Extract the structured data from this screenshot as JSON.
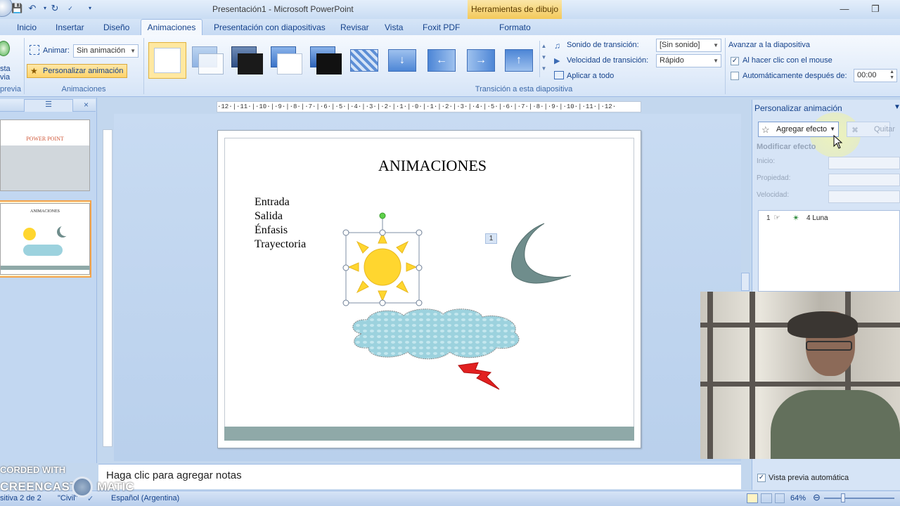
{
  "window": {
    "title": "Presentación1 - Microsoft PowerPoint",
    "context_tab_group": "Herramientas de dibujo"
  },
  "ribbon_tabs": [
    "Inicio",
    "Insertar",
    "Diseño",
    "Animaciones",
    "Presentación con diapositivas",
    "Revisar",
    "Vista",
    "Foxit PDF",
    "Formato"
  ],
  "ribbon": {
    "preview": {
      "label_top": "sta",
      "label_bottom": "via",
      "group": "previa"
    },
    "animaciones_group": {
      "animar_label": "Animar:",
      "animar_value": "Sin animación",
      "personalizar_label": "Personalizar animación",
      "group_label": "Animaciones"
    },
    "transition_group": {
      "sound_label": "Sonido de transición:",
      "sound_value": "[Sin sonido]",
      "speed_label": "Velocidad de transición:",
      "speed_value": "Rápido",
      "apply_all": "Aplicar a todo",
      "group_label": "Transición a esta diapositiva"
    },
    "advance": {
      "title": "Avanzar a la diapositiva",
      "on_click": "Al hacer clic con el mouse",
      "on_click_checked": true,
      "auto_after": "Automáticamente después de:",
      "auto_checked": false,
      "time_value": "00:00"
    }
  },
  "slides_pane": {
    "thumb1_title": "POWER POINT",
    "thumb2_title": "ANIMACIONES"
  },
  "ruler": {
    "top": "·12·|·11·|·10·|·9·|·8·|·7·|·6·|·5·|·4·|·3·|·2·|·1·|·0·|·1·|·2·|·3·|·4·|·5·|·6·|·7·|·8·|·9·|·10·|·11·|·12·"
  },
  "slide": {
    "title": "ANIMACIONES",
    "bullets": [
      "Entrada",
      "Salida",
      "Énfasis",
      "Trayectoria"
    ],
    "anim_tag": "1"
  },
  "notes": {
    "placeholder": "Haga clic para agregar notas"
  },
  "task_pane": {
    "title": "Personalizar animación",
    "add_effect": "Agregar efecto",
    "remove": "Quitar",
    "modify_title": "Modificar efecto",
    "inicio_label": "Inicio:",
    "propiedad_label": "Propiedad:",
    "velocidad_label": "Velocidad:",
    "effects": [
      {
        "order": "1",
        "name": "4 Luna"
      }
    ],
    "auto_preview": "Vista previa automática",
    "auto_preview_checked": true
  },
  "statusbar": {
    "slide_info": "sitiva 2 de 2",
    "theme": "\"Civil\"",
    "language": "Español (Argentina)",
    "zoom": "64%"
  },
  "watermark": {
    "line1": "CORDED WITH",
    "line2": "CREENCAST",
    "line3": "MATIC"
  },
  "colors": {
    "ribbon_blue": "#15428b",
    "highlight_orange": "#ffd56a",
    "sun": "#ffd62f",
    "moon": "#6f8d8c",
    "cloud": "#9cd2de",
    "lightning": "#e22020"
  }
}
